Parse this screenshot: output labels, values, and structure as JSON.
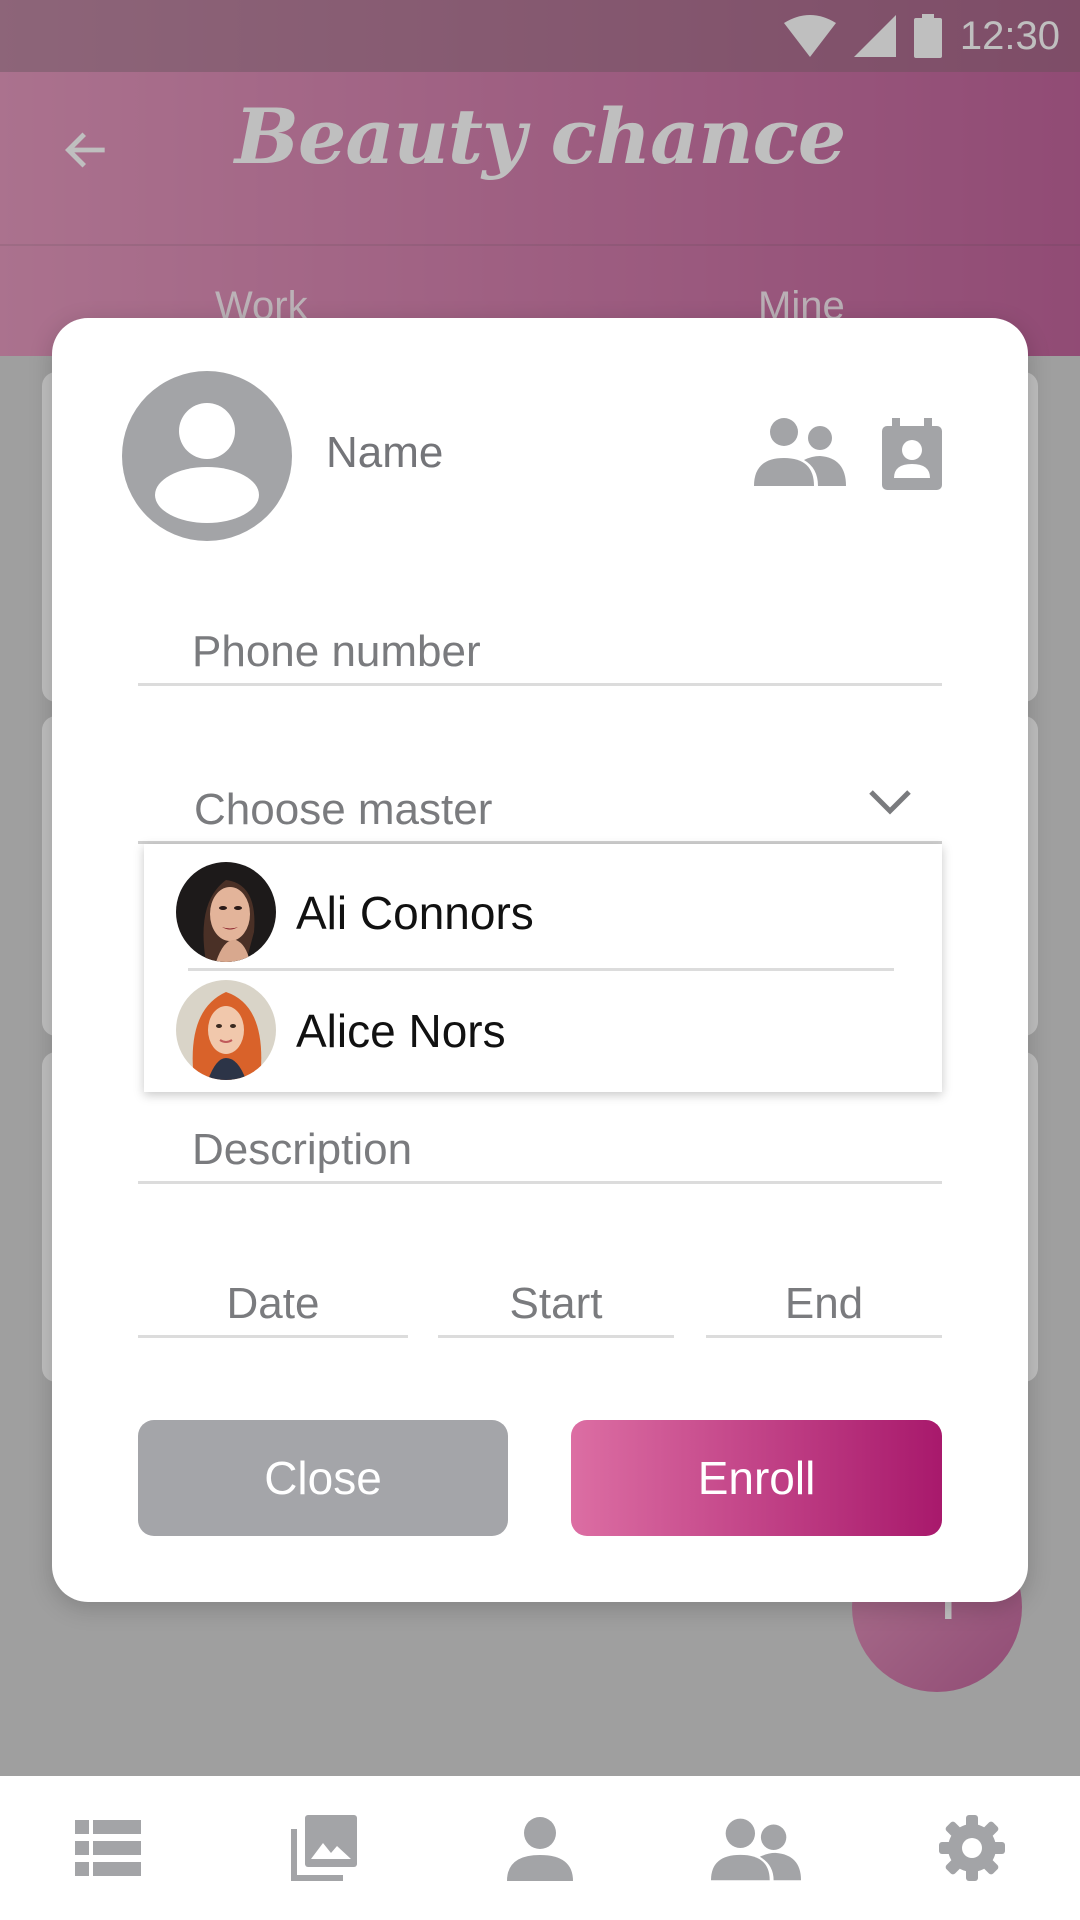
{
  "status_bar": {
    "time": "12:30"
  },
  "app_bar": {
    "title": "Beauty chance"
  },
  "tabs": [
    "Work",
    "Mine"
  ],
  "fab": {
    "label": "+"
  },
  "dialog": {
    "name_placeholder": "Name",
    "phone_placeholder": "Phone number",
    "master_placeholder": "Choose master",
    "masters": [
      {
        "name": "Ali Connors"
      },
      {
        "name": "Alice Nors"
      }
    ],
    "description_placeholder": "Description",
    "date_placeholder": "Date",
    "start_placeholder": "Start",
    "end_placeholder": "End",
    "close_label": "Close",
    "enroll_label": "Enroll"
  },
  "bottom_nav": [
    "list-icon",
    "photo-library-icon",
    "person-icon",
    "people-icon",
    "settings-icon"
  ],
  "colors": {
    "accent_start": "#dc6ea3",
    "accent_end": "#a8196c",
    "grey_button": "#a4a5a9",
    "icon_grey": "#a3a4a7"
  }
}
